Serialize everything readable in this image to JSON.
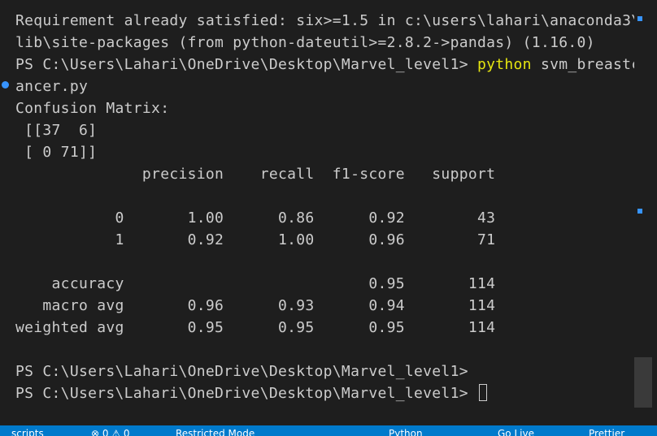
{
  "terminal": {
    "lines": [
      "Requirement already satisfied: six>=1.5 in c:\\users\\lahari\\anaconda3\\",
      "lib\\site-packages (from python-dateutil>=2.8.2->pandas) (1.16.0)",
      "ancer.py",
      "Confusion Matrix:",
      " [[37  6]",
      " [ 0 71]]",
      "              precision    recall  f1-score   support",
      "",
      "           0       1.00      0.86      0.92        43",
      "           1       0.92      1.00      0.96        71",
      "",
      "    accuracy                           0.95       114",
      "   macro avg       0.96      0.93      0.94       114",
      "weighted avg       0.95      0.95      0.95       114",
      "",
      "PS C:\\Users\\Lahari\\OneDrive\\Desktop\\Marvel_level1>"
    ],
    "command_prompt": "PS C:\\Users\\Lahari\\OneDrive\\Desktop\\Marvel_level1> ",
    "command_name": "python",
    "command_args": " svm_breastc",
    "final_prompt": "PS C:\\Users\\Lahari\\OneDrive\\Desktop\\Marvel_level1> "
  },
  "statusbar": {
    "items": [
      "scripts",
      "⊗ 0 ⚠ 0",
      "Restricted Mode",
      "Python",
      "Go Live",
      "Prettier"
    ]
  },
  "colors": {
    "background": "#1e1e1e",
    "text": "#cccccc",
    "command": "#e5e510",
    "statusbar": "#007acc",
    "accent": "#3794ff"
  }
}
